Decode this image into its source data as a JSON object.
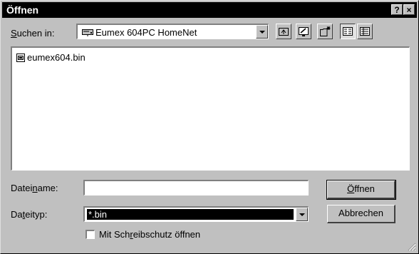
{
  "window": {
    "title": "Öffnen",
    "help_label": "?",
    "close_label": "×"
  },
  "lookin": {
    "label_pre": "",
    "label_u": "S",
    "label_post": "uchen in:",
    "value": "Eumex 604PC HomeNet"
  },
  "toolbar": {
    "icons": [
      "up-folder-icon",
      "desktop-icon",
      "new-folder-icon",
      "list-view-icon",
      "details-view-icon"
    ]
  },
  "files": [
    {
      "name": "eumex604.bin",
      "icon": "bin-file-icon"
    }
  ],
  "filename": {
    "label_pre": "Datei",
    "label_u": "n",
    "label_post": "ame:",
    "value": ""
  },
  "filetype": {
    "label_pre": "Da",
    "label_u": "t",
    "label_post": "eityp:",
    "value": "*.bin"
  },
  "buttons": {
    "open_pre": "",
    "open_u": "Ö",
    "open_post": "ffnen",
    "cancel": "Abbrechen"
  },
  "readonly": {
    "label_pre": "Mit Sch",
    "label_u": "r",
    "label_post": "eibschutz öffnen",
    "checked": false
  },
  "colors": {
    "titlebar": "#000000",
    "face": "#c0c0c0",
    "highlight": "#000000"
  }
}
